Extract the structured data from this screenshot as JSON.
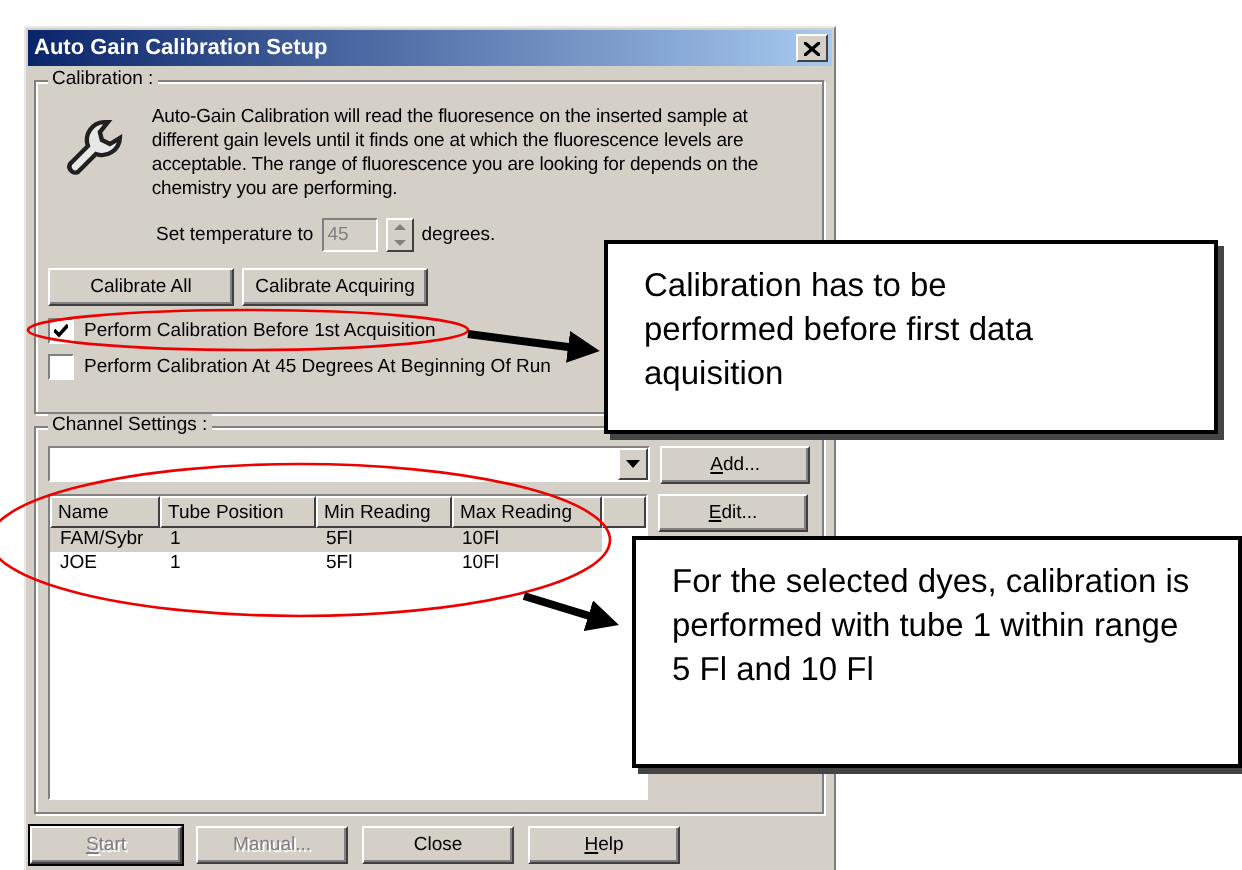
{
  "window": {
    "title": "Auto Gain Calibration Setup"
  },
  "calibration": {
    "label": "Calibration :",
    "description": "Auto-Gain Calibration will read the fluoresence on the inserted sample at different gain levels until it finds one at which the fluorescence levels are acceptable. The range of fluorescence you are looking for depends on the chemistry you are performing.",
    "temperature_label": "Set temperature to",
    "temperature_value": "45",
    "temperature_disabled": true,
    "temperature_unit": "degrees.",
    "buttons": [
      {
        "label": "Calibrate All"
      },
      {
        "label": "Calibrate Acquiring"
      }
    ],
    "checkboxes": [
      {
        "label": "Perform Calibration Before 1st Acquisition",
        "checked": true
      },
      {
        "label": "Perform Calibration At 45 Degrees At Beginning Of Run",
        "checked": false
      }
    ]
  },
  "channel_settings": {
    "label": "Channel Settings :",
    "side_buttons": [
      {
        "label": "Add...",
        "access_key_underlined": true
      },
      {
        "label": "Edit...",
        "access_key_underlined": true
      }
    ],
    "columns": [
      "Name",
      "Tube Position",
      "Min Reading",
      "Max Reading"
    ],
    "rows": [
      {
        "cells": [
          "FAM/Sybr",
          "1",
          "5Fl",
          "10Fl"
        ],
        "selected": true
      },
      {
        "cells": [
          "JOE",
          "1",
          "5Fl",
          "10Fl"
        ],
        "selected": false
      }
    ]
  },
  "footer_buttons": [
    {
      "label": "Start",
      "disabled": true,
      "access_key_underlined": true
    },
    {
      "label": "Manual...",
      "disabled": true,
      "access_key_underlined": false
    },
    {
      "label": "Close",
      "disabled": false,
      "access_key_underlined": false
    },
    {
      "label": "Help",
      "disabled": false,
      "access_key_underlined": true
    }
  ],
  "callouts": [
    {
      "text": "Calibration has to be performed before first data aquisition"
    },
    {
      "text": "For the selected dyes, calibration is performed with tube 1 within range 5 Fl and 10 Fl"
    }
  ]
}
